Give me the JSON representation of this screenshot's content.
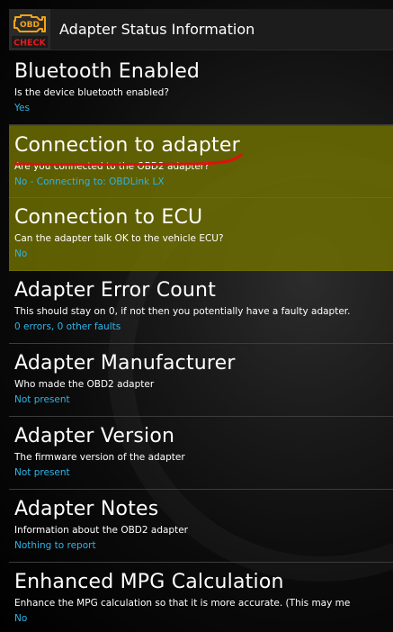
{
  "header": {
    "app_icon": "obd-check-engine-icon",
    "icon_text_top": "OBD",
    "icon_text_bottom": "CHECK",
    "title": "Adapter Status Information"
  },
  "colors": {
    "highlight": "#707000",
    "value_text": "#2fb3e6",
    "annotation_stroke": "#e01010"
  },
  "items": [
    {
      "title": "Bluetooth Enabled",
      "description": "Is the device bluetooth enabled?",
      "value": "Yes"
    },
    {
      "title": "Connection to adapter",
      "description": "Are you connected to the OBD2 adapter?",
      "value": "No - Connecting to: OBDLink LX"
    },
    {
      "title": "Connection to ECU",
      "description": "Can the adapter talk OK to the vehicle ECU?",
      "value": "No"
    },
    {
      "title": "Adapter Error Count",
      "description": "This should stay on 0, if not then you potentially have a faulty adapter.",
      "value": "0 errors, 0 other faults"
    },
    {
      "title": "Adapter Manufacturer",
      "description": "Who made the OBD2 adapter",
      "value": "Not present"
    },
    {
      "title": "Adapter Version",
      "description": "The firmware version of the adapter",
      "value": "Not present"
    },
    {
      "title": "Adapter Notes",
      "description": "Information about the OBD2 adapter",
      "value": "Nothing to report"
    },
    {
      "title": "Enhanced MPG Calculation",
      "description": "Enhance the MPG calculation so that it is more accurate. (This may me",
      "value": "No"
    }
  ]
}
